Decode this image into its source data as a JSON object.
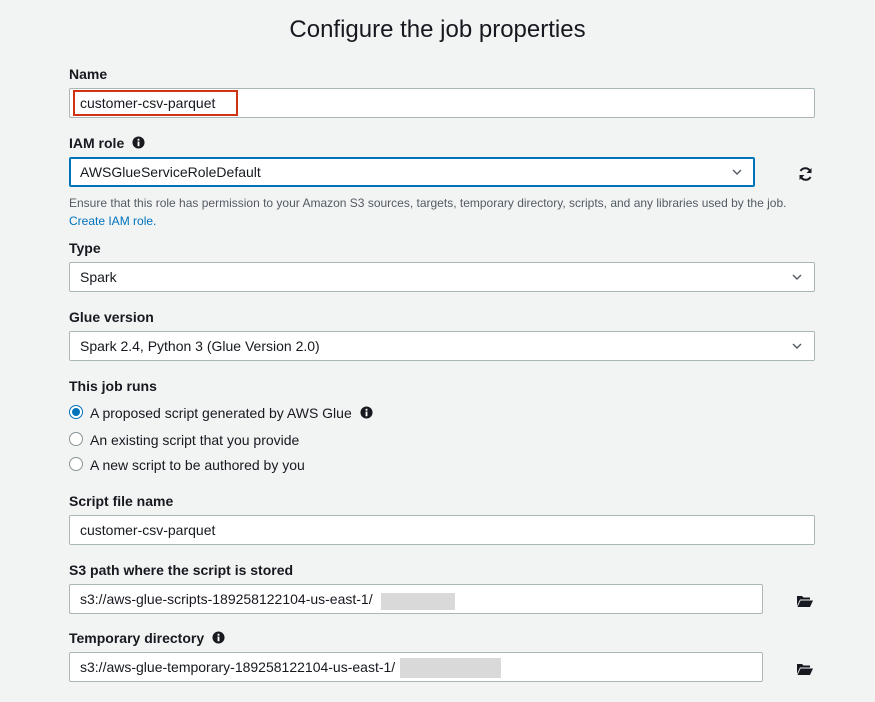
{
  "page": {
    "title": "Configure the job properties"
  },
  "name": {
    "label": "Name",
    "value": "customer-csv-parquet"
  },
  "iam_role": {
    "label": "IAM role",
    "value": "AWSGlueServiceRoleDefault",
    "help": "Ensure that this role has permission to your Amazon S3 sources, targets, temporary directory, scripts, and any libraries used by the job.",
    "create_link": "Create IAM role."
  },
  "type": {
    "label": "Type",
    "value": "Spark"
  },
  "glue_version": {
    "label": "Glue version",
    "value": "Spark 2.4, Python 3 (Glue Version 2.0)"
  },
  "job_runs": {
    "label": "This job runs",
    "options": [
      {
        "label": "A proposed script generated by AWS Glue",
        "checked": true
      },
      {
        "label": "An existing script that you provide",
        "checked": false
      },
      {
        "label": "A new script to be authored by you",
        "checked": false
      }
    ]
  },
  "script_file": {
    "label": "Script file name",
    "value": "customer-csv-parquet"
  },
  "s3_path": {
    "label": "S3 path where the script is stored",
    "value": "s3://aws-glue-scripts-189258122104-us-east-1/"
  },
  "temp_dir": {
    "label": "Temporary directory",
    "value": "s3://aws-glue-temporary-189258122104-us-east-1/"
  },
  "icons": {
    "info": "info-icon",
    "refresh": "refresh-icon",
    "folder": "folder-open-icon",
    "dropdown": "chevron-down-icon"
  },
  "colors": {
    "accent": "#0073bb",
    "highlight": "#d13212",
    "background": "#f2f3f3"
  }
}
